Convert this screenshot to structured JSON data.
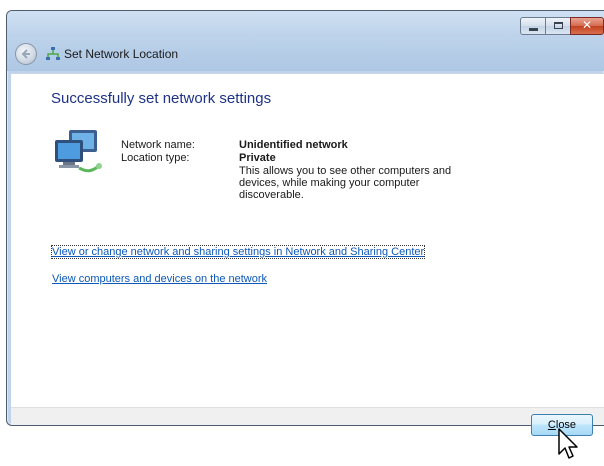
{
  "window": {
    "title": "Set Network Location",
    "caption_buttons": {
      "minimize": "–",
      "maximize": "□",
      "close": "✕"
    }
  },
  "main": {
    "heading": "Successfully set network settings",
    "icon": "network-computers-icon",
    "network_name_label": "Network name:",
    "network_name_value": "Unidentified network",
    "location_type_label": "Location type:",
    "location_type_value": "Private",
    "description": "This allows you to see other computers and devices, while making your computer discoverable.",
    "links": [
      "View or change network and sharing settings in Network and Sharing Center",
      "View computers and devices on the network"
    ]
  },
  "footer": {
    "close_label_accel": "C",
    "close_label_rest": "lose"
  },
  "colors": {
    "heading": "#1e3287",
    "link": "#0d58b8",
    "title_bar": "#bcd2ea",
    "close_caption": "#c2401f"
  }
}
